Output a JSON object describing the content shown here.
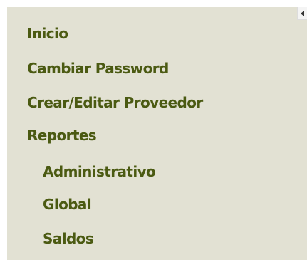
{
  "colors": {
    "panel_background": "#e2e1d3",
    "menu_text": "#4b5a12"
  },
  "collapse_button": {
    "icon": "caret-left-icon"
  },
  "menu": {
    "items": [
      {
        "label": "Inicio"
      },
      {
        "label": "Cambiar Password"
      },
      {
        "label": "Crear/Editar Proveedor"
      },
      {
        "label": "Reportes"
      },
      {
        "label": "Administrativo"
      },
      {
        "label": "Global"
      },
      {
        "label": "Saldos"
      }
    ]
  }
}
